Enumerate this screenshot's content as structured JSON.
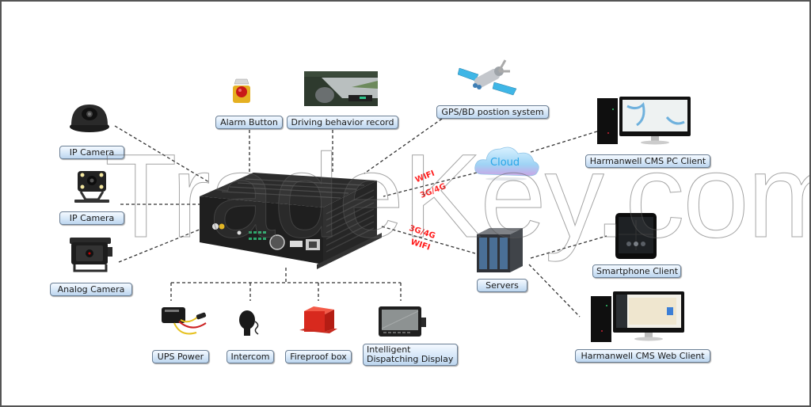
{
  "diagram": {
    "watermark": "TradeKey.com",
    "center_device": "Mobile DVR",
    "nodes": {
      "ip_camera_dome": {
        "label": "IP Camera",
        "icon": "dome-camera-icon"
      },
      "ip_camera_bracket": {
        "label": "IP Camera",
        "icon": "bracket-camera-icon"
      },
      "analog_camera": {
        "label": "Analog Camera",
        "icon": "analog-camera-icon"
      },
      "alarm_button": {
        "label": "Alarm Button",
        "icon": "alarm-button-icon"
      },
      "driving_record": {
        "label": "Driving behavior record",
        "icon": "driving-photo-icon"
      },
      "gps": {
        "label": "GPS/BD postion system",
        "icon": "satellite-icon"
      },
      "cloud": {
        "label": "Cloud",
        "icon": "cloud-icon"
      },
      "servers": {
        "label": "Servers",
        "icon": "server-rack-icon"
      },
      "pc_client": {
        "label": "Harmanwell CMS PC Client",
        "icon": "desktop-pc-icon"
      },
      "smartphone_client": {
        "label": "Smartphone Client",
        "icon": "tablet-icon"
      },
      "web_client": {
        "label": "Harmanwell CMS Web Client",
        "icon": "desktop-pc-icon"
      },
      "ups_power": {
        "label": "UPS Power",
        "icon": "ups-module-icon"
      },
      "intercom": {
        "label": "Intercom",
        "icon": "handheld-mic-icon"
      },
      "fireproof_box": {
        "label": "Fireproof box",
        "icon": "fireproof-box-icon"
      },
      "dispatch_display": {
        "label_line1": "Intelligent",
        "label_line2": "Dispatching Display",
        "icon": "display-monitor-icon"
      }
    },
    "network_labels": {
      "upper_wifi": "WIFI",
      "upper_cell": "3G/4G",
      "lower_cell": "3G/4G",
      "lower_wifi": "WIFI"
    },
    "colors": {
      "label_border": "#6b7f95",
      "label_fill": "#d6e7f8",
      "network_text": "#ff1a1a",
      "cloud_text": "#2aa6e8",
      "connector": "#333333"
    }
  }
}
